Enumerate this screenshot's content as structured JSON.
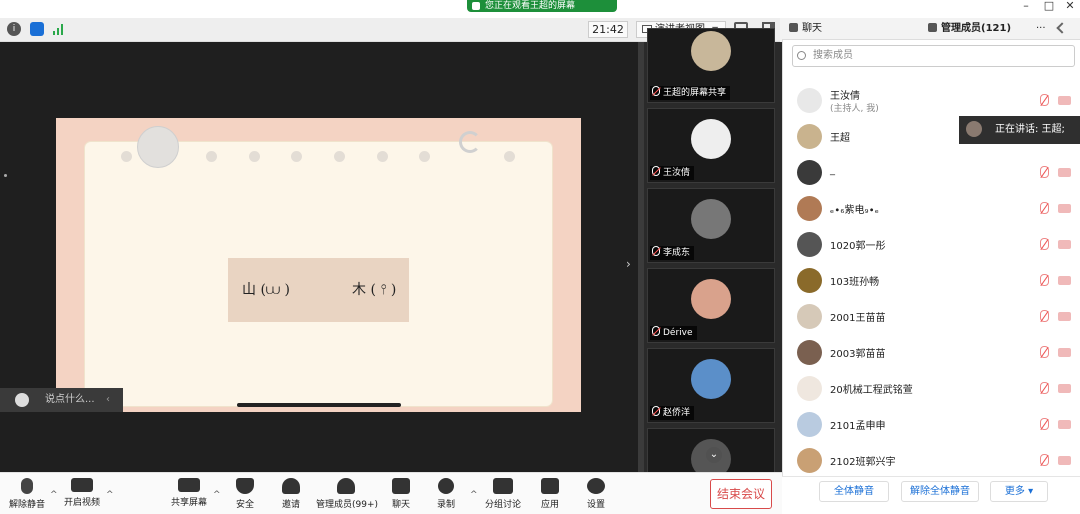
{
  "title_bar": {
    "banner": "您正在观看王超的屏幕",
    "minimize": "–",
    "maximize": "□",
    "close": "✕"
  },
  "meeting_bar": {
    "time": "21:42",
    "view_label": "演讲者视图",
    "info_icon": "info-icon",
    "shield_icon": "shield-icon",
    "signal_icon": "signal-icon"
  },
  "slide": {
    "char1": "山 (⩊ )",
    "char2": "木 ( ⫯ )"
  },
  "chat_input": {
    "placeholder": "说点什么...",
    "arrow": "‹"
  },
  "gallery": {
    "tiles": [
      {
        "label": "王超的屏幕共享",
        "avatar_color": "#c8b79a"
      },
      {
        "label": "王汝倩",
        "avatar_color": "#eeeeee"
      },
      {
        "label": "李成东",
        "avatar_color": "#777777"
      },
      {
        "label": "Dérive",
        "avatar_color": "#d9a28c"
      },
      {
        "label": "赵侨洋",
        "avatar_color": "#5b8fc9"
      },
      {
        "label": "",
        "avatar_color": "#555555"
      }
    ],
    "scroll_down": "⌄",
    "chevron": "›"
  },
  "toolbar": {
    "unmute": "解除静音",
    "start_video": "开启视频",
    "share_screen": "共享屏幕",
    "security": "安全",
    "invite": "邀请",
    "manage_members": "管理成员(99+)",
    "chat": "聊天",
    "record": "录制",
    "breakout": "分组讨论",
    "apps": "应用",
    "settings": "设置",
    "end_meeting": "结束会议",
    "caret": "^"
  },
  "panel": {
    "tab_chat": "聊天",
    "tab_members": "管理成员(121)",
    "more": "···",
    "search_placeholder": "搜索成员",
    "speaking": "正在讲话: 王超;",
    "members": [
      {
        "name": "王汝倩",
        "sub": "(主持人, 我)",
        "avatar_color": "#e8e8e8"
      },
      {
        "name": "王超",
        "sub": "",
        "avatar_color": "#c9b38e"
      },
      {
        "name": "_",
        "sub": "",
        "avatar_color": "#3a3a3a"
      },
      {
        "name": "ₑ∙₆紫电₉∙ₑ",
        "sub": "",
        "avatar_color": "#b07a55"
      },
      {
        "name": "1020郭一彤",
        "sub": "",
        "avatar_color": "#555555"
      },
      {
        "name": "103班孙畅",
        "sub": "",
        "avatar_color": "#8a6a2a"
      },
      {
        "name": "2001王苗苗",
        "sub": "",
        "avatar_color": "#d6c9b8"
      },
      {
        "name": "2003郭苗苗",
        "sub": "",
        "avatar_color": "#7a6050"
      },
      {
        "name": "20机械工程武铭萱",
        "sub": "",
        "avatar_color": "#efe7df"
      },
      {
        "name": "2101孟申申",
        "sub": "",
        "avatar_color": "#b9cbe0"
      },
      {
        "name": "2102班郭兴宇",
        "sub": "",
        "avatar_color": "#c9a074"
      }
    ],
    "mute_all": "全体静音",
    "unmute_all": "解除全体静音",
    "more_btn": "更多 ▾"
  },
  "colors": {
    "accent": "#1a6fd6",
    "end_red": "#d84a4a",
    "banner_green": "#1d8f3a"
  }
}
